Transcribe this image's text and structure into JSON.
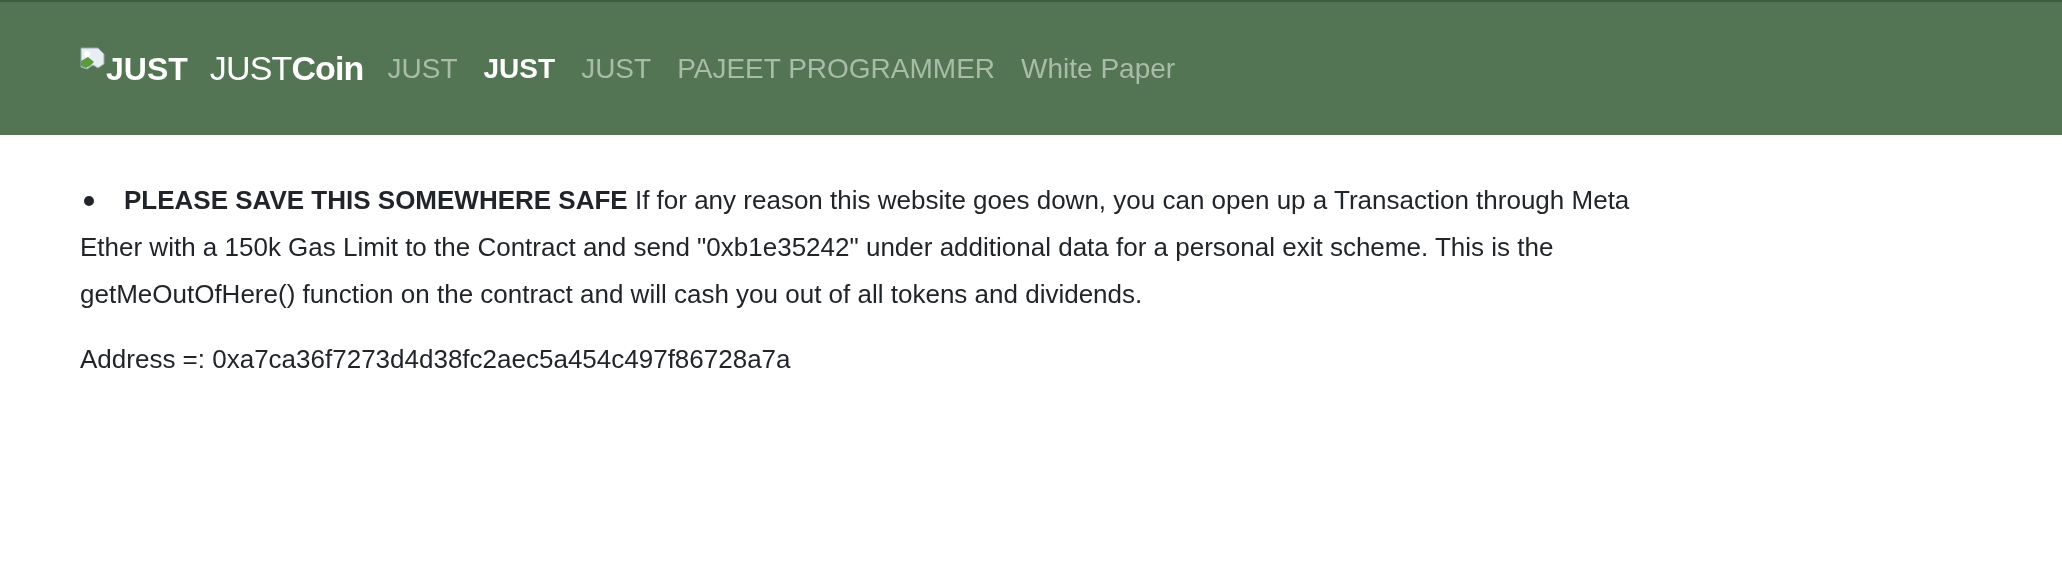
{
  "navbar": {
    "logo_alt": "JUST",
    "brand": {
      "light": "JUST",
      "bold": "Coin"
    },
    "items": [
      {
        "label": "JUST",
        "selected": false
      },
      {
        "label": "JUST",
        "selected": true
      },
      {
        "label": "JUST",
        "selected": false
      },
      {
        "label": "PAJEET PROGRAMMER",
        "selected": false
      },
      {
        "label": "White Paper",
        "selected": false
      }
    ]
  },
  "notice": {
    "lines": [
      "**PLEASE SAVE THIS SOMEWHERE SAFE** If for any reason this website goes down, you can open up a Transaction through Meta",
      "Ether with a 150k Gas Limit to the Contract and send \"0xb1e35242\" under additional data for a personal exit scheme. This is the",
      "getMeOutOfHere() function on the contract and will cash you out of all tokens and dividends."
    ]
  },
  "address": "Address =: 0xa7ca36f7273d4d38fc2aec5a454c497f86728a7a"
}
